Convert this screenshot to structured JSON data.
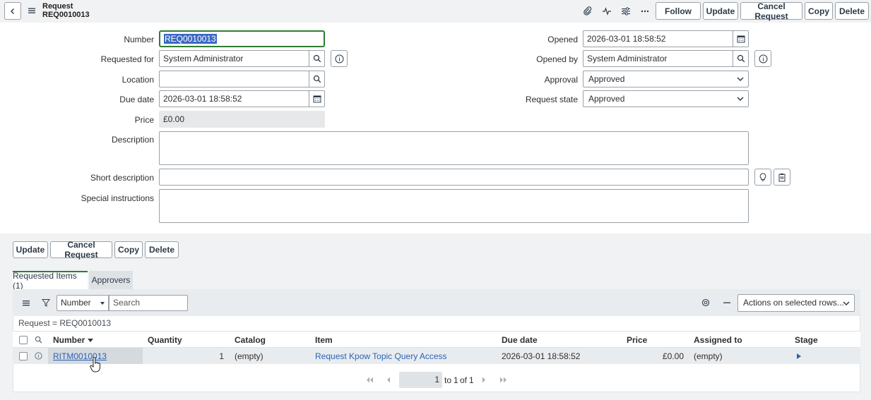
{
  "header": {
    "record_type": "Request",
    "record_number": "REQ0010013",
    "buttons": {
      "follow": "Follow",
      "update": "Update",
      "cancel_request": "Cancel Request",
      "copy": "Copy",
      "delete": "Delete"
    },
    "icons": [
      "paperclip-icon",
      "activity-icon",
      "sliders-icon",
      "more-icon"
    ]
  },
  "form": {
    "number": {
      "label": "Number",
      "value": "REQ0010013"
    },
    "requested_for": {
      "label": "Requested for",
      "value": "System Administrator"
    },
    "location": {
      "label": "Location",
      "value": ""
    },
    "due_date": {
      "label": "Due date",
      "value": "2026-03-01 18:58:52"
    },
    "price": {
      "label": "Price",
      "value": "£0.00"
    },
    "description": {
      "label": "Description",
      "value": ""
    },
    "short_description": {
      "label": "Short description",
      "value": ""
    },
    "special_instructions": {
      "label": "Special instructions",
      "value": ""
    },
    "opened": {
      "label": "Opened",
      "value": "2026-03-01 18:58:52"
    },
    "opened_by": {
      "label": "Opened by",
      "value": "System Administrator"
    },
    "approval": {
      "label": "Approval",
      "value": "Approved"
    },
    "request_state": {
      "label": "Request state",
      "value": "Approved"
    }
  },
  "footer_buttons": {
    "update": "Update",
    "cancel_request": "Cancel Request",
    "copy": "Copy",
    "delete": "Delete"
  },
  "tabs": [
    {
      "label": "Requested Items (1)",
      "active": true
    },
    {
      "label": "Approvers",
      "active": false
    }
  ],
  "list": {
    "search_field": "Number",
    "search_placeholder": "Search",
    "actions_select": "Actions on selected rows...",
    "breadcrumb": "Request = REQ0010013",
    "columns": [
      "Number",
      "Quantity",
      "Catalog",
      "Item",
      "Due date",
      "Price",
      "Assigned to",
      "Stage"
    ],
    "rows": [
      {
        "number": "RITM0010013",
        "quantity": "1",
        "catalog": "(empty)",
        "item": "Request Kpow Topic Query Access",
        "due_date": "2026-03-01 18:58:52",
        "price": "£0.00",
        "assigned_to": "(empty)"
      }
    ],
    "pager": {
      "current": "1",
      "to_label": "to",
      "to_value": "1",
      "of_label": "of",
      "total": "1"
    }
  },
  "colors": {
    "accent_green": "#2e7d32",
    "link_blue": "#2c63b5",
    "selection_blue": "#3a68c4"
  }
}
